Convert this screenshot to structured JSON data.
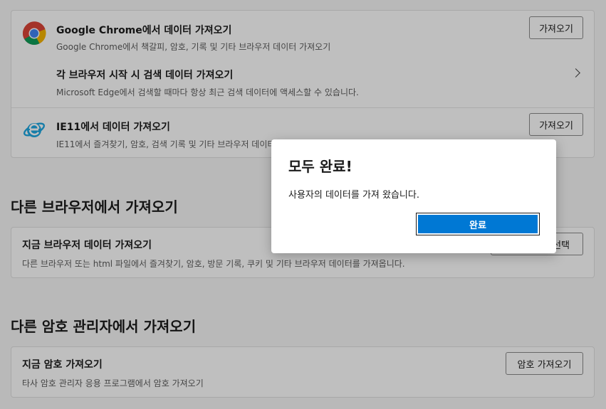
{
  "import_card": {
    "chrome": {
      "title": "Google Chrome에서 데이터 가져오기",
      "desc": "Google Chrome에서 책갈피, 암호, 기록 및 기타 브라우저 데이터 가져오기",
      "button": "가져오기",
      "icon": "chrome-icon"
    },
    "search_on_start": {
      "title": "각 브라우저 시작 시 검색 데이터 가져오기",
      "desc": "Microsoft Edge에서 검색할 때마다 항상 최근 검색 데이터에 액세스할 수 있습니다.",
      "icon": "chevron-right-icon"
    },
    "ie11": {
      "title": "IE11에서 데이터 가져오기",
      "desc": "IE11에서 즐겨찾기, 암호, 검색 기록 및 기타 브라우저 데이터 가져오기",
      "button": "가져오기",
      "icon": "internet-explorer-icon"
    }
  },
  "other_browsers": {
    "heading": "다른 브라우저에서 가져오기",
    "title": "지금 브라우저 데이터 가져오기",
    "desc": "다른 브라우저 또는 html 파일에서 즐겨찾기, 암호, 방문 기록, 쿠키 및 기타 브라우저 데이터를 가져옵니다.",
    "button": "가져올 항목 선택"
  },
  "password_managers": {
    "heading": "다른 암호 관리자에서 가져오기",
    "title": "지금 암호 가져오기",
    "desc": "타사 암호 관리자 응용 프로그램에서 암호 가져오기",
    "button": "암호 가져오기"
  },
  "dialog": {
    "title": "모두 완료!",
    "message": "사용자의 데이터를 가져 왔습니다.",
    "confirm": "완료"
  },
  "colors": {
    "accent": "#0078d4",
    "overlay": "rgba(0,0,0,0.25)"
  }
}
